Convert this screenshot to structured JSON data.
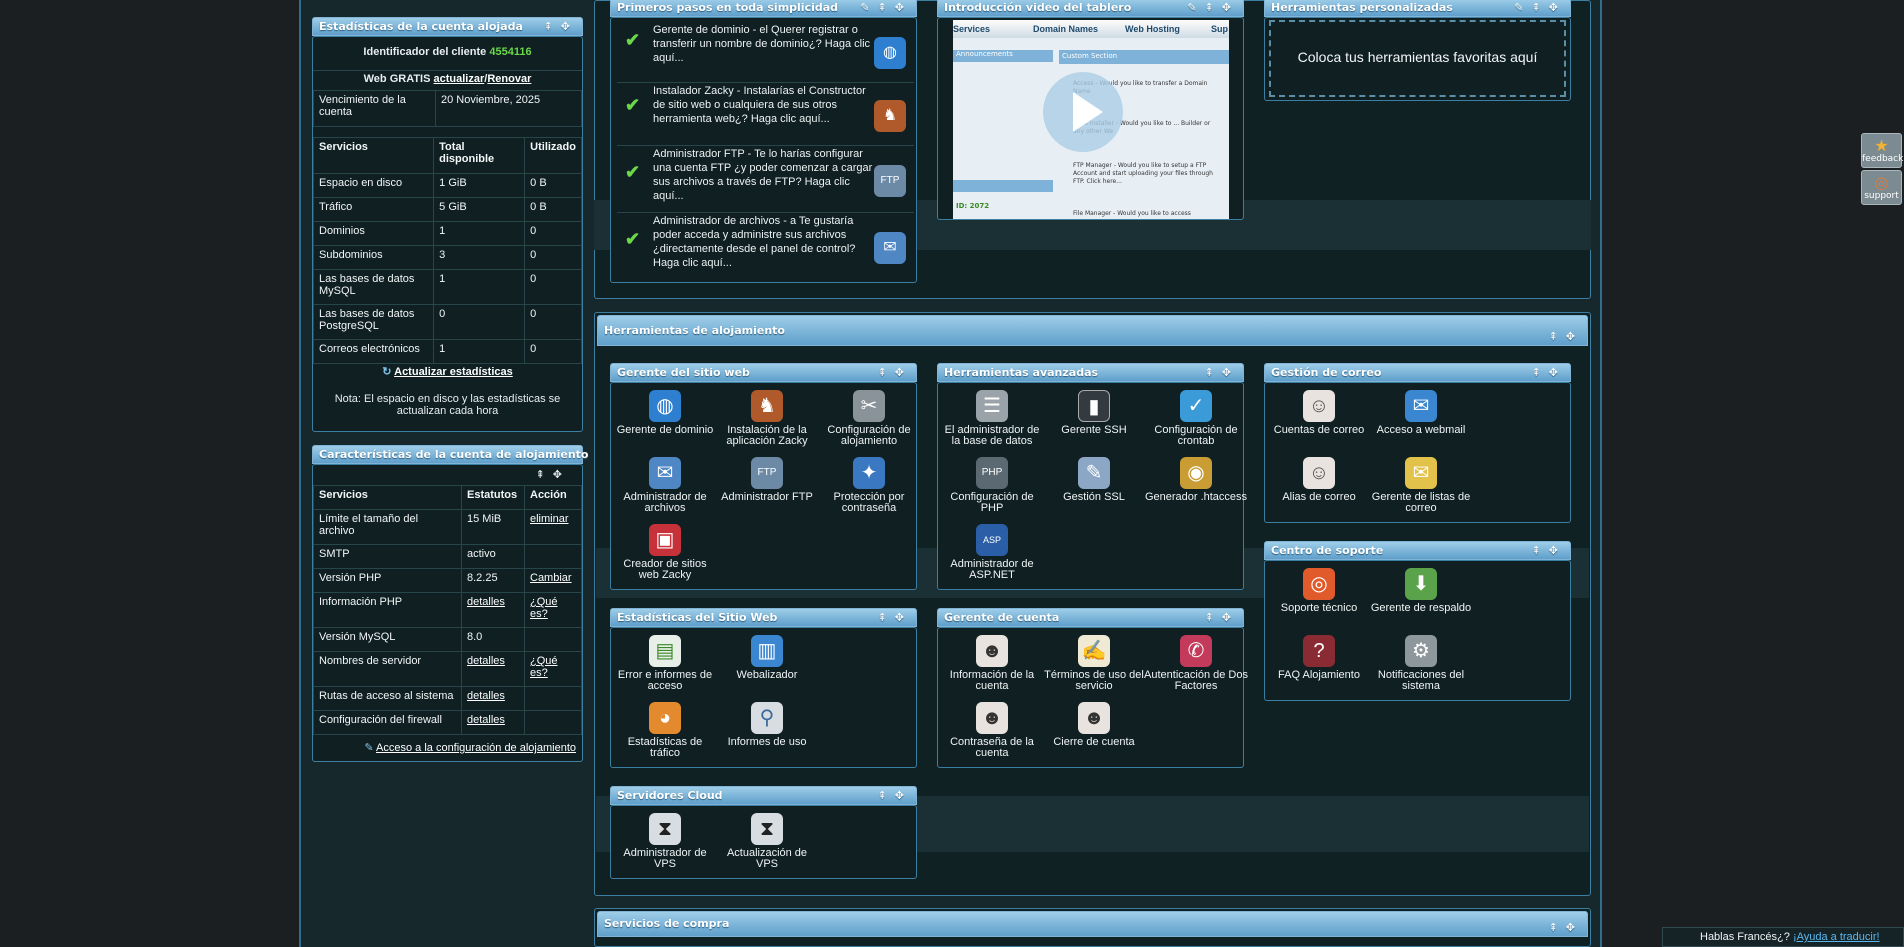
{
  "stats_panel": {
    "title": "Estadísticas de la cuenta alojada",
    "client_id_label": "Identificador del cliente",
    "client_id": "4554116",
    "web_free_label": "Web GRATIS",
    "upgrade_link": "actualizar",
    "slash": "/",
    "renew_link": "Renovar",
    "expiry_label": "Vencimiento de la cuenta",
    "expiry_value": "20 Noviembre, 2025",
    "headers": [
      "Servicios",
      "Total disponible",
      "Utilizado"
    ],
    "rows": [
      [
        "Espacio en disco",
        "1 GiB",
        "0 B"
      ],
      [
        "Tráfico",
        "5 GiB",
        "0 B"
      ],
      [
        "Dominios",
        "1",
        "0"
      ],
      [
        "Subdominios",
        "3",
        "0"
      ],
      [
        "Las bases de datos MySQL",
        "1",
        "0"
      ],
      [
        "Las bases de datos PostgreSQL",
        "0",
        "0"
      ],
      [
        "Correos electrónicos",
        "1",
        "0"
      ]
    ],
    "update_link": "Actualizar estadísticas",
    "note": "Nota: El espacio en disco y las estadísticas se actualizan cada hora"
  },
  "features_panel": {
    "title": "Características de la cuenta de alojamiento",
    "headers": [
      "Servicios",
      "Estatutos",
      "Acción"
    ],
    "rows": [
      [
        "Límite el tamaño del archivo",
        "15 MiB",
        "eliminar"
      ],
      [
        "SMTP",
        "activo",
        ""
      ],
      [
        "Versión PHP",
        "8.2.25",
        "Cambiar"
      ],
      [
        "Información PHP",
        "detalles",
        "¿Qué es?"
      ],
      [
        "Versión MySQL",
        "8.0",
        ""
      ],
      [
        "Nombres de servidor",
        "detalles",
        "¿Qué es?"
      ],
      [
        "Rutas de acceso al sistema",
        "detalles",
        ""
      ],
      [
        "Configuración del firewall",
        "detalles",
        ""
      ]
    ],
    "footer_link": "Acceso a la configuración de alojamiento"
  },
  "first_steps": {
    "title": "Primeros pasos en toda simplicidad",
    "items": [
      {
        "text": "Gerente de dominio - el Querer registrar o transferir un nombre de dominio¿? Haga clic aquí...",
        "icon": "www-globe-icon"
      },
      {
        "text": "Instalador Zacky - Instalarías el Constructor de sitio web o cualquiera de sus otros herramienta web¿? Haga clic aquí...",
        "icon": "kangaroo-icon"
      },
      {
        "text": "Administrador FTP - Te lo harías configurar una cuenta FTP ¿y poder comenzar a cargar sus archivos a través de FTP? Haga clic aquí...",
        "icon": "ftp-folder-icon"
      },
      {
        "text": "Administrador de archivos - a Te gustaría poder acceda y administre sus archivos ¿directamente desde el panel de control? Haga clic aquí...",
        "icon": "file-manager-icon"
      }
    ]
  },
  "video_intro": {
    "title": "Introducción video del tablero",
    "tabs": [
      "Services",
      "Domain Names",
      "Web Hosting",
      "Sup"
    ],
    "left_heading": "Announcements",
    "right_heading": "Custom Section",
    "snippets": [
      "Access - Would you like to transfer a Domain Name",
      "Tools Installer - Would you like to ... Builder or any other We",
      "FTP Manager - Would you like to setup a FTP Account and start uploading your files through FTP. Click here...",
      "File Manager - Would you like to access"
    ],
    "id_text": "ID: 2072"
  },
  "custom_tools": {
    "title": "Herramientas personalizadas",
    "placeholder": "Coloca tus herramientas favoritas aquí"
  },
  "hosting_tools": {
    "title": "Herramientas de alojamiento",
    "groups": [
      {
        "title": "Gerente del sitio web",
        "items": [
          "Gerente de dominio",
          "Instalación de la aplicación Zacky",
          "Configuración de alojamiento",
          "Administrador de archivos",
          "Administrador FTP",
          "Protección por contraseña",
          "Creador de sitios web Zacky"
        ]
      },
      {
        "title": "Herramientas avanzadas",
        "items": [
          "El administrador de la base de datos",
          "Gerente SSH",
          "Configuración de crontab",
          "Configuración de PHP",
          "Gestión SSL",
          "Generador .htaccess",
          "Administrador de ASP.NET"
        ]
      },
      {
        "title": "Gestión de correo",
        "items": [
          "Cuentas de correo",
          "Acceso a webmail",
          "Alias de correo",
          "Gerente de listas de correo"
        ]
      },
      {
        "title": "Centro de soporte",
        "items": [
          "Soporte técnico",
          "Gerente de respaldo",
          "FAQ Alojamiento",
          "Notificaciones del sistema"
        ]
      },
      {
        "title": "Estadísticas del Sitio Web",
        "items": [
          "Error e informes de acceso",
          "Webalizador",
          "Estadísticas de tráfico",
          "Informes de uso"
        ]
      },
      {
        "title": "Gerente de cuenta",
        "items": [
          "Información de la cuenta",
          "Términos de uso del servicio",
          "Autenticación de Dos Factores",
          "Contraseña de la cuenta",
          "Cierre de cuenta"
        ]
      },
      {
        "title": "Servidores Cloud",
        "items": [
          "Administrador de VPS",
          "Actualización de VPS"
        ]
      }
    ]
  },
  "purchase": {
    "title": "Servicios de compra"
  },
  "side_buttons": {
    "feedback": "feedback",
    "support": "support"
  },
  "translate_bar": {
    "text": "Hablas Francés¿?",
    "link": "¡Ayuda a traducir!"
  },
  "colors": {
    "bar_gradient_top": "#9ecde8",
    "bar_gradient_bottom": "#5f9fcb",
    "accent_green": "#6bd84a",
    "page_bg": "#16282c"
  }
}
